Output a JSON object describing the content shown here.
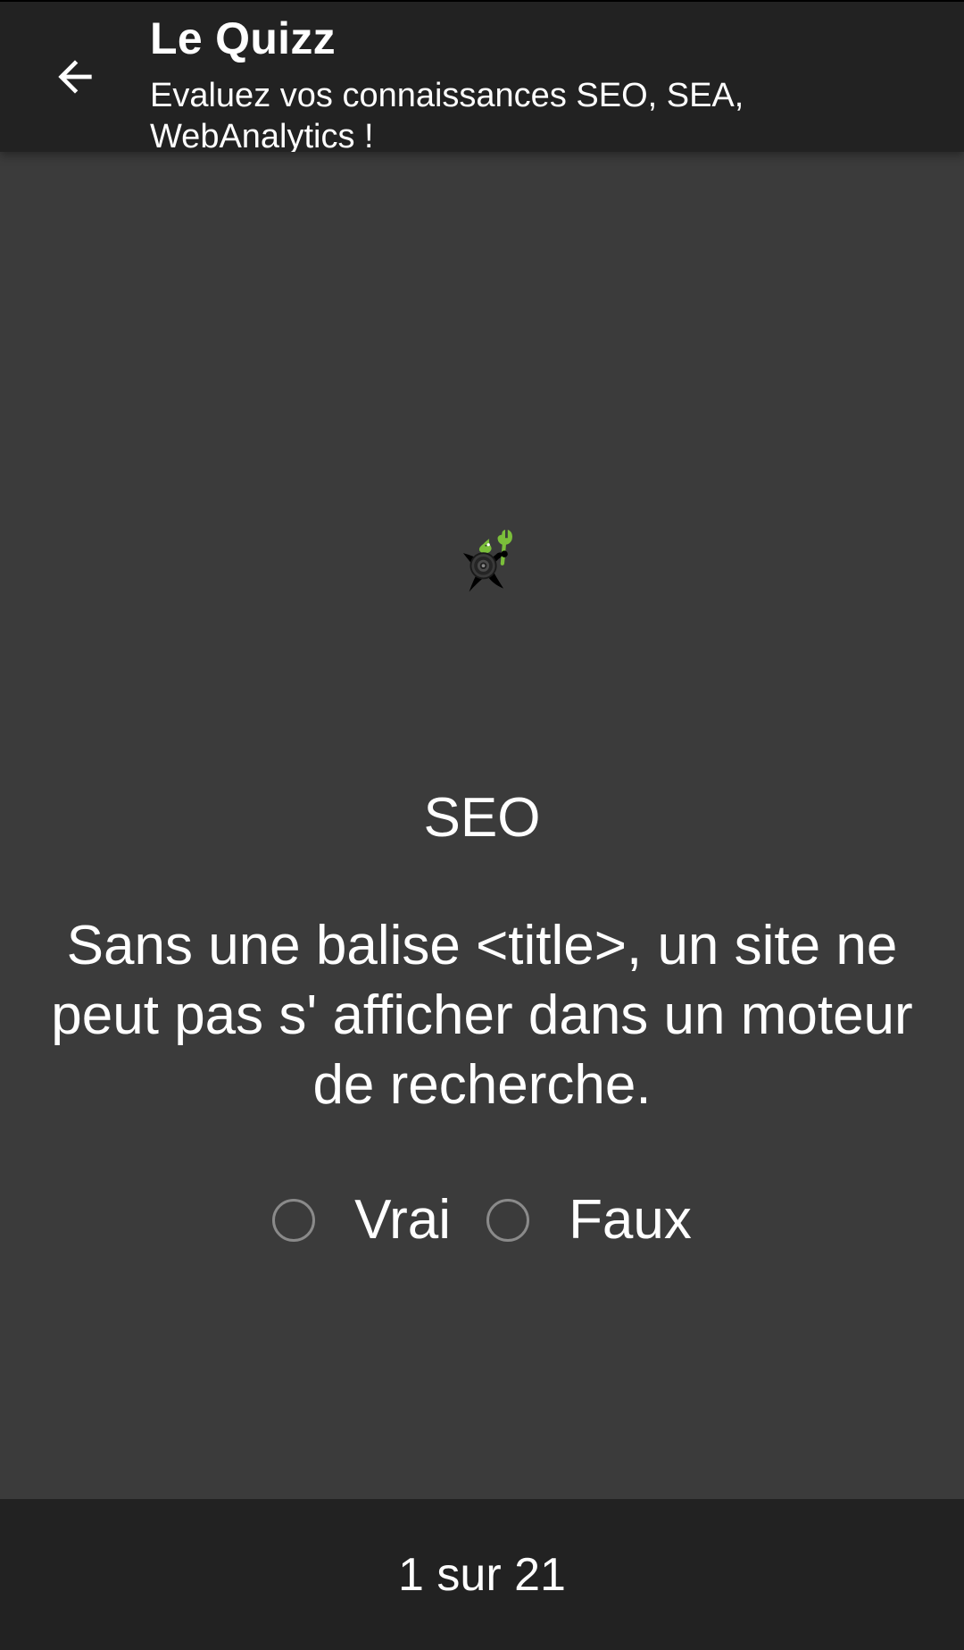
{
  "header": {
    "title": "Le Quizz",
    "subtitle": "Evaluez vos connaissances SEO, SEA, WebAnalytics !",
    "back_icon": "arrow-left-icon"
  },
  "quiz": {
    "category": "SEO",
    "question": "Sans une balise <title>, un site ne peut pas s' afficher dans un moteur de recherche.",
    "options": [
      {
        "label": "Vrai",
        "selected": false
      },
      {
        "label": "Faux",
        "selected": false
      }
    ],
    "mascot_icon": "mascot-speaker-wrench-icon"
  },
  "footer": {
    "progress": "1 sur 21"
  },
  "colors": {
    "background": "#3b3b3b",
    "bar": "#222222",
    "accent_green": "#7bbf3a",
    "text": "#ffffff"
  }
}
